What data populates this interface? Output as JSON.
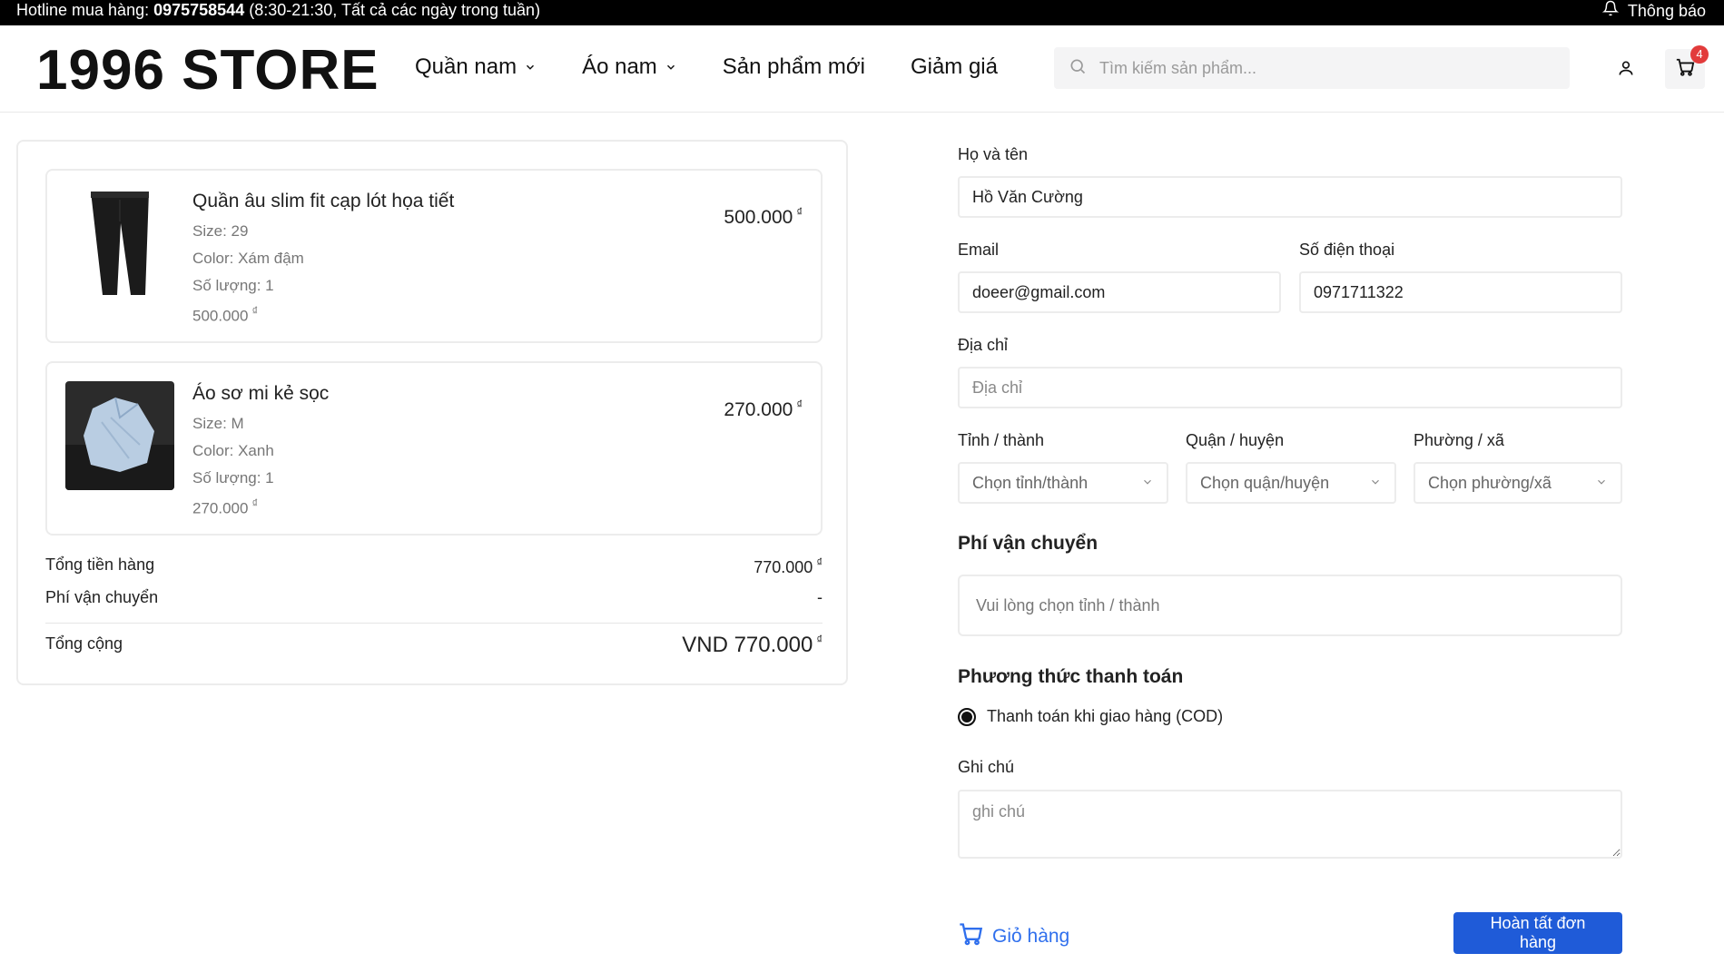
{
  "topbar": {
    "hotline_label": "Hotline mua hàng: ",
    "hotline_number": "0975758544",
    "hotline_hours": " (8:30-21:30, Tất cả các ngày trong tuần)",
    "notification_label": "Thông báo"
  },
  "header": {
    "logo": "1996 STORE",
    "nav": [
      {
        "label": "Quần nam",
        "has_dropdown": true
      },
      {
        "label": "Áo nam",
        "has_dropdown": true
      },
      {
        "label": "Sản phẩm mới",
        "has_dropdown": false
      },
      {
        "label": "Giảm giá",
        "has_dropdown": false
      }
    ],
    "search_placeholder": "Tìm kiếm sản phẩm...",
    "cart_count": "4"
  },
  "order": {
    "currency_symbol": "₫",
    "items": [
      {
        "name": "Quần âu slim fit cạp lót họa tiết",
        "size": "Size: 29",
        "color": "Color: Xám đậm",
        "quantity": "Số lượng: 1",
        "unit_price": "500.000",
        "price": "500.000",
        "image": "black-trousers"
      },
      {
        "name": "Áo sơ mi kẻ sọc",
        "size": "Size: M",
        "color": "Color: Xanh",
        "quantity": "Số lượng: 1",
        "unit_price": "270.000",
        "price": "270.000",
        "image": "light-blue-shirt"
      }
    ],
    "subtotal_label": "Tổng tiền hàng",
    "subtotal_value": "770.000",
    "shipping_label": "Phí vận chuyển",
    "shipping_value": "-",
    "total_label": "Tổng cộng",
    "total_value": "VND 770.000"
  },
  "form": {
    "fullname_label": "Họ và tên",
    "fullname_value": "Hồ Văn Cường",
    "email_label": "Email",
    "email_value": "doeer@gmail.com",
    "phone_label": "Số điện thoại",
    "phone_value": "0971711322",
    "address_label": "Địa chỉ",
    "address_placeholder": "Địa chỉ",
    "province_label": "Tỉnh / thành",
    "province_placeholder": "Chọn tỉnh/thành",
    "district_label": "Quận / huyện",
    "district_placeholder": "Chọn quận/huyện",
    "ward_label": "Phường / xã",
    "ward_placeholder": "Chọn phường/xã",
    "shipping_title": "Phí vận chuyển",
    "shipping_note": "Vui lòng chọn tỉnh / thành",
    "payment_title": "Phương thức thanh toán",
    "payment_option": "Thanh toán khi giao hàng (COD)",
    "note_label": "Ghi chú",
    "note_placeholder": "ghi chú",
    "back_link": "Giỏ hàng",
    "submit": "Hoàn tất đơn hàng"
  },
  "colors": {
    "accent": "#1f5bd8",
    "link": "#2f6fed",
    "badge": "#e23b3b"
  }
}
